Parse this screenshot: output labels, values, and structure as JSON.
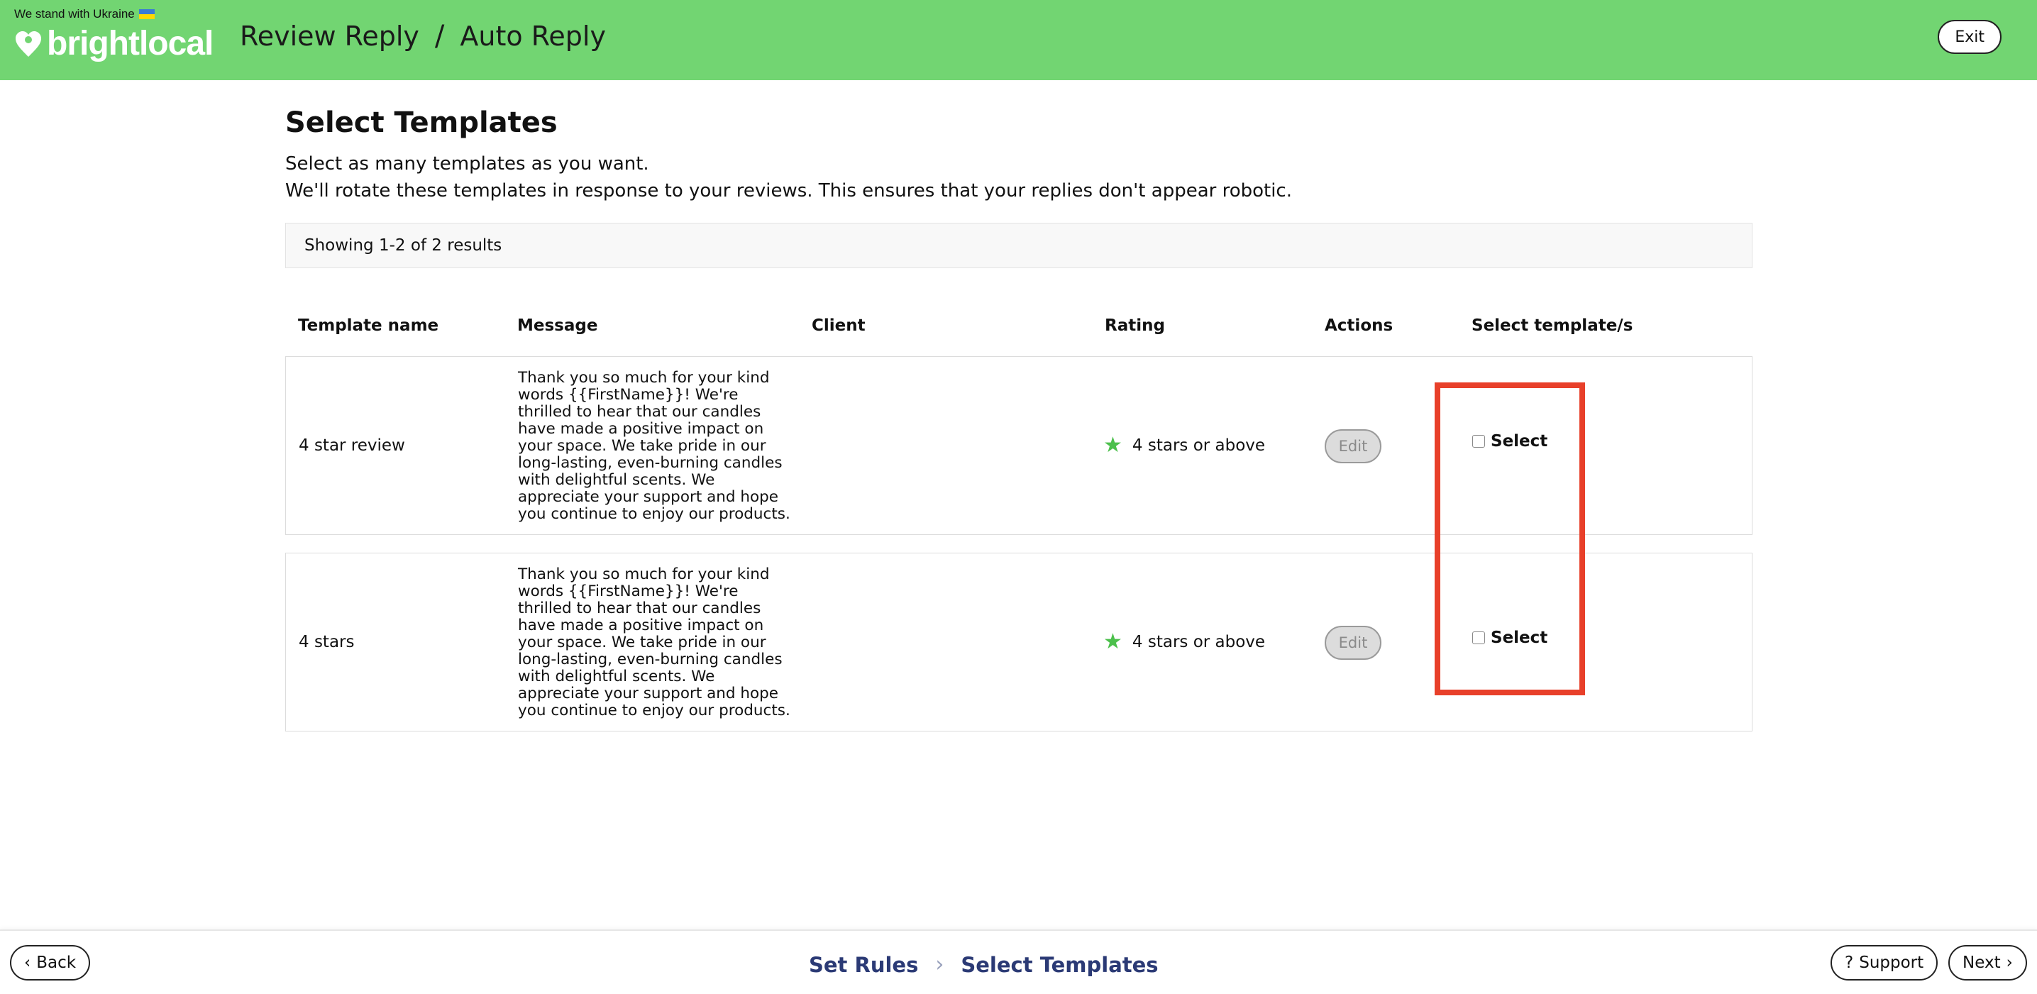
{
  "header": {
    "banner": "We stand with Ukraine",
    "logo_text": "brightlocal",
    "breadcrumb": [
      "Review Reply",
      "Auto Reply"
    ],
    "exit_label": "Exit"
  },
  "main": {
    "title": "Select Templates",
    "subtitle1": "Select as many templates as you want.",
    "subtitle2": "We'll rotate these templates in response to your reviews. This ensures that your replies don't appear robotic.",
    "results_text": "Showing 1-2 of 2 results",
    "columns": [
      "Template name",
      "Message",
      "Client",
      "Rating",
      "Actions",
      "Select template/s"
    ],
    "rows": [
      {
        "name": "4 star review",
        "message": "Thank you so much for your kind words {{FirstName}}! We're thrilled to hear that our candles have made a positive impact on your space. We take pride in our long-lasting, even-burning candles with delightful scents. We appreciate your support and hope you continue to enjoy our products.",
        "client": "",
        "rating": "4 stars or above",
        "action_label": "Edit",
        "select_label": "Select"
      },
      {
        "name": "4 stars",
        "message": "Thank you so much for your kind words {{FirstName}}! We're thrilled to hear that our candles have made a positive impact on your space. We take pride in our long-lasting, even-burning candles with delightful scents. We appreciate your support and hope you continue to enjoy our products.",
        "client": "",
        "rating": "4 stars or above",
        "action_label": "Edit",
        "select_label": "Select"
      }
    ]
  },
  "footer": {
    "back_label": "Back",
    "steps": [
      "Set Rules",
      "Select Templates"
    ],
    "support_label": "Support",
    "next_label": "Next"
  },
  "colors": {
    "header_bg": "#72d572",
    "highlight": "#e8402a",
    "step_text": "#2b3a75",
    "star": "#4cc04c"
  }
}
